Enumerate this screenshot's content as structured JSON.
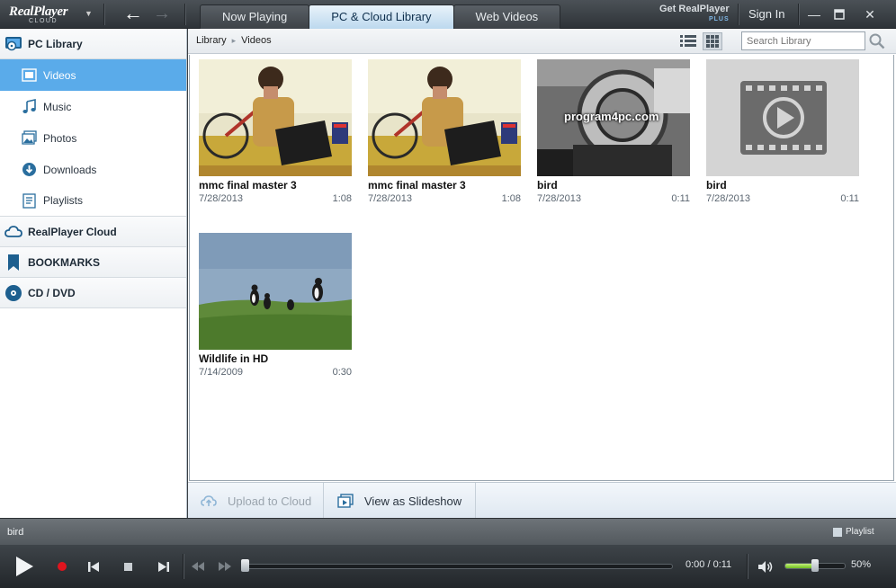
{
  "app": {
    "logo_text": "RealPlayer",
    "logo_sub": "CLOUD",
    "get_plus": "Get RealPlayer",
    "get_plus_sub": "PLUS",
    "sign_in": "Sign In"
  },
  "tabs": [
    {
      "label": "Now Playing",
      "active": false
    },
    {
      "label": "PC & Cloud Library",
      "active": true
    },
    {
      "label": "Web Videos",
      "active": false
    }
  ],
  "sidebar": {
    "pc_library": "PC Library",
    "items": [
      {
        "label": "Videos",
        "icon": "video-icon",
        "active": true
      },
      {
        "label": "Music",
        "icon": "music-note-icon",
        "active": false
      },
      {
        "label": "Photos",
        "icon": "photos-icon",
        "active": false
      },
      {
        "label": "Downloads",
        "icon": "download-icon",
        "active": false
      },
      {
        "label": "Playlists",
        "icon": "playlist-icon",
        "active": false
      }
    ],
    "cloud": "RealPlayer Cloud",
    "bookmarks": "BOOKMARKS",
    "cd_dvd": "CD / DVD"
  },
  "toolbar": {
    "breadcrumb": [
      "Library",
      "Videos"
    ],
    "search_placeholder": "Search Library"
  },
  "videos": [
    {
      "title": "mmc final master 3",
      "date": "7/28/2013",
      "duration": "1:08",
      "thumb": "man-at-laptop"
    },
    {
      "title": "mmc final master 3",
      "date": "7/28/2013",
      "duration": "1:08",
      "thumb": "man-at-laptop"
    },
    {
      "title": "bird",
      "date": "7/28/2013",
      "duration": "0:11",
      "thumb": "program4pc-watermark",
      "watermark": "program4pc.com"
    },
    {
      "title": "bird",
      "date": "7/28/2013",
      "duration": "0:11",
      "thumb": "generic-video-placeholder"
    },
    {
      "title": "Wildlife in HD",
      "date": "7/14/2009",
      "duration": "0:30",
      "thumb": "birds-on-grass"
    }
  ],
  "actions": {
    "upload": "Upload to Cloud",
    "slideshow": "View as Slideshow"
  },
  "player": {
    "now_playing": "bird",
    "playlist_label": "Playlist",
    "time": "0:00 / 0:11",
    "progress": 0.0,
    "volume_pct": "50%",
    "volume": 0.5
  },
  "colors": {
    "accent": "#5aabea",
    "active_tab": "#d3e7f5",
    "record": "#e0141e",
    "volume_fill": "#8fd42f"
  }
}
